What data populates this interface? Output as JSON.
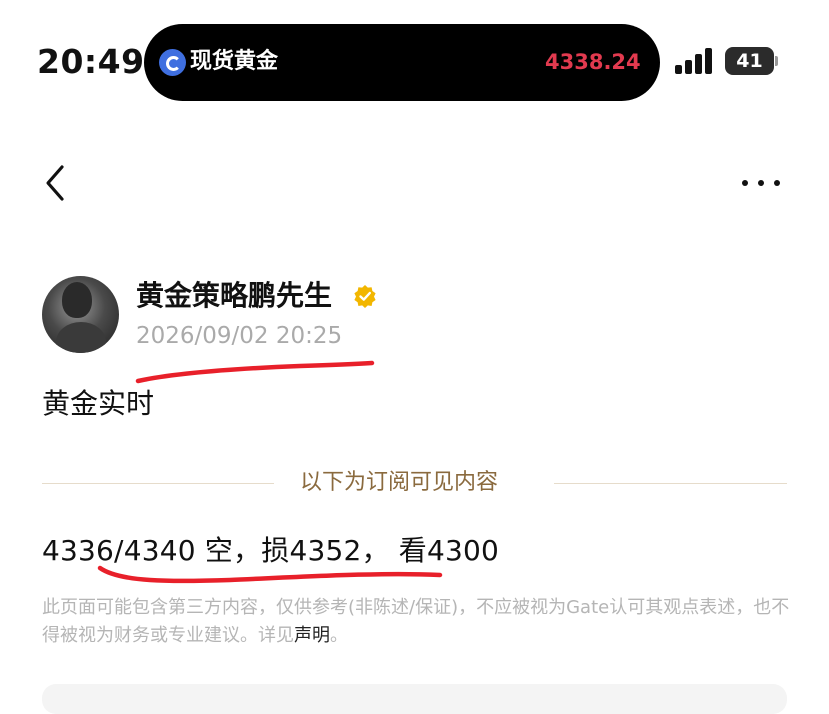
{
  "status_bar": {
    "time": "20:49",
    "island_title": "现货黄金",
    "island_price": "4338.24",
    "battery": "41",
    "price_color": "#e23a4f"
  },
  "nav": {
    "back_icon": "chevron-left-icon",
    "more_icon": "ellipsis-icon"
  },
  "post": {
    "author_name": "黄金策略鹏先生",
    "verified_icon": "verified-badge-icon",
    "timestamp": "2026/09/02 20:25",
    "title": "黄金实时",
    "subscription_divider": "以下为订阅可见内容",
    "content": "4336/4340 空，损4352， 看4300",
    "disclaimer_text": "此页面可能包含第三方内容，仅供参考(非陈述/保证)，不应被视为Gate认可其观点表述，也不得被视为财务或专业建议。详见",
    "disclaimer_link": "声明",
    "disclaimer_end": "。"
  },
  "colors": {
    "accent_gold": "#8a6a3e",
    "verified_gold": "#f2b600",
    "annotation_red": "#e8202a"
  }
}
